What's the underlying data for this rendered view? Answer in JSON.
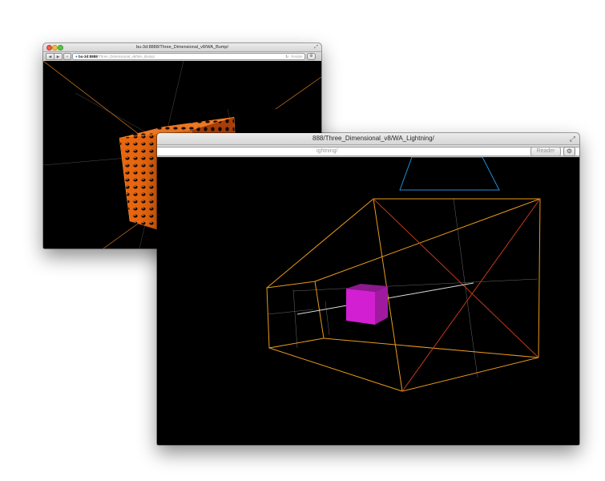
{
  "back_window": {
    "title": "bu-3d:8888/Three_Dimensional_v8/WA_Bump/",
    "url_host": "bu-3d:8888",
    "url_path": "/Three_Dimensional_v8/WA_Bump/",
    "reader_label": "Reader",
    "reload_glyph": "↻",
    "back_glyph": "◀",
    "forward_glyph": "▶",
    "gear_glyph": "⚙",
    "resize_glyph": "⤢",
    "scene_colors": {
      "cube": "#e8660f",
      "cube_dark": "#8a2e02",
      "lines": "#d97a1a",
      "grid": "#8a8a8a"
    },
    "icons": [
      "close-light-icon",
      "minimize-light-icon",
      "zoom-light-icon",
      "back-arrow-icon",
      "forward-arrow-icon",
      "reload-icon",
      "gear-icon",
      "resize-icon"
    ]
  },
  "front_window": {
    "title": "888/Three_Dimensional_v8/WA_Lightning/",
    "url_tail": "ightning/",
    "reader_label": "Reader",
    "reload_glyph": "↻",
    "gear_glyph": "⚙",
    "resize_glyph": "⤢",
    "scene_colors": {
      "frustum": "#e89a1c",
      "diagonal": "#c0391b",
      "camera": "#1e8fd6",
      "cube_front": "#d11fd1",
      "cube_top": "#8c1a8c",
      "cube_side": "#a01aa0",
      "beam": "#dcdcdc",
      "grid": "#6a6a6a"
    },
    "icons": [
      "reload-icon",
      "gear-icon",
      "resize-icon"
    ]
  }
}
